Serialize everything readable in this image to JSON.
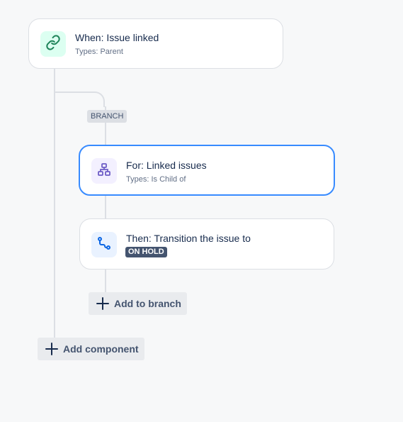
{
  "trigger": {
    "title": "When: Issue linked",
    "subtitle": "Types: Parent",
    "icon": "link-icon"
  },
  "branch": {
    "label": "BRANCH",
    "condition": {
      "title": "For: Linked issues",
      "subtitle": "Types: Is Child of",
      "icon": "hierarchy-icon"
    },
    "action": {
      "title": "Then: Transition the issue to",
      "status": "ON HOLD",
      "icon": "transition-icon"
    },
    "add_button_label": "Add to branch"
  },
  "add_component_label": "Add component",
  "colors": {
    "selected_border": "#388bff",
    "trigger_icon_bg": "#dcfff1",
    "trigger_icon": "#1f845a",
    "branch_icon_bg": "#f3f0ff",
    "branch_icon": "#6e5dc6",
    "action_icon_bg": "#e9f2ff",
    "action_icon": "#0c66e4"
  }
}
